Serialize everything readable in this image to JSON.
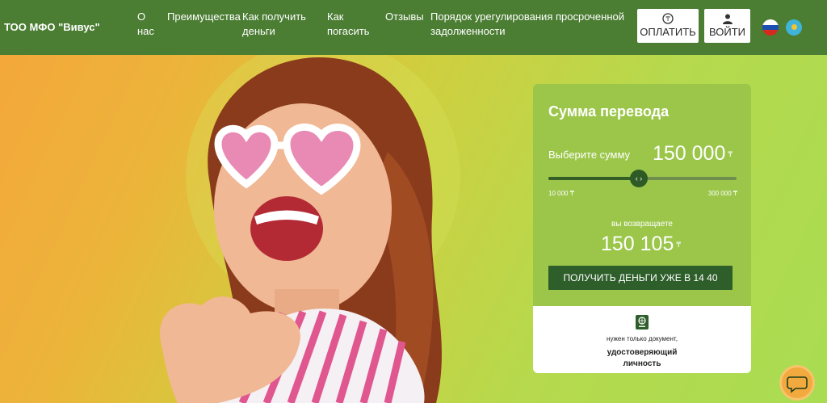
{
  "header": {
    "logo": "ТОО МФО \"Вивус\"",
    "nav": [
      {
        "line1": "О",
        "line2": "нас"
      },
      {
        "line1": "Преимущества",
        "line2": ""
      },
      {
        "line1": "Как получить",
        "line2": "деньги"
      },
      {
        "line1": "Как",
        "line2": "погасить"
      },
      {
        "line1": "Отзывы",
        "line2": ""
      },
      {
        "line1": "Порядок урегулирования просроченной",
        "line2": "задолженности"
      }
    ],
    "pay_label": "ОПЛАТИТЬ",
    "login_label": "ВОЙТИ",
    "languages": [
      "ru-flag-icon",
      "kz-flag-icon"
    ],
    "color": "#4b7d33"
  },
  "calculator": {
    "title": "Сумма перевода",
    "choose_label": "Выберите сумму",
    "amount": "150 000",
    "currency": "₸",
    "slider_fraction": 0.4828,
    "min_label": "10 000 ₸",
    "max_label": "300 000 ₸",
    "return_label": "вы возвращаете",
    "return_amount": "150 105",
    "button_label": "ПОЛУЧИТЬ ДЕНЬГИ УЖЕ В 14 40",
    "doc_note": "нужен только документ,",
    "doc_bold1": "удостоверяющий",
    "doc_bold2": "личность"
  },
  "chat_icon": "chat-bubble-icon"
}
